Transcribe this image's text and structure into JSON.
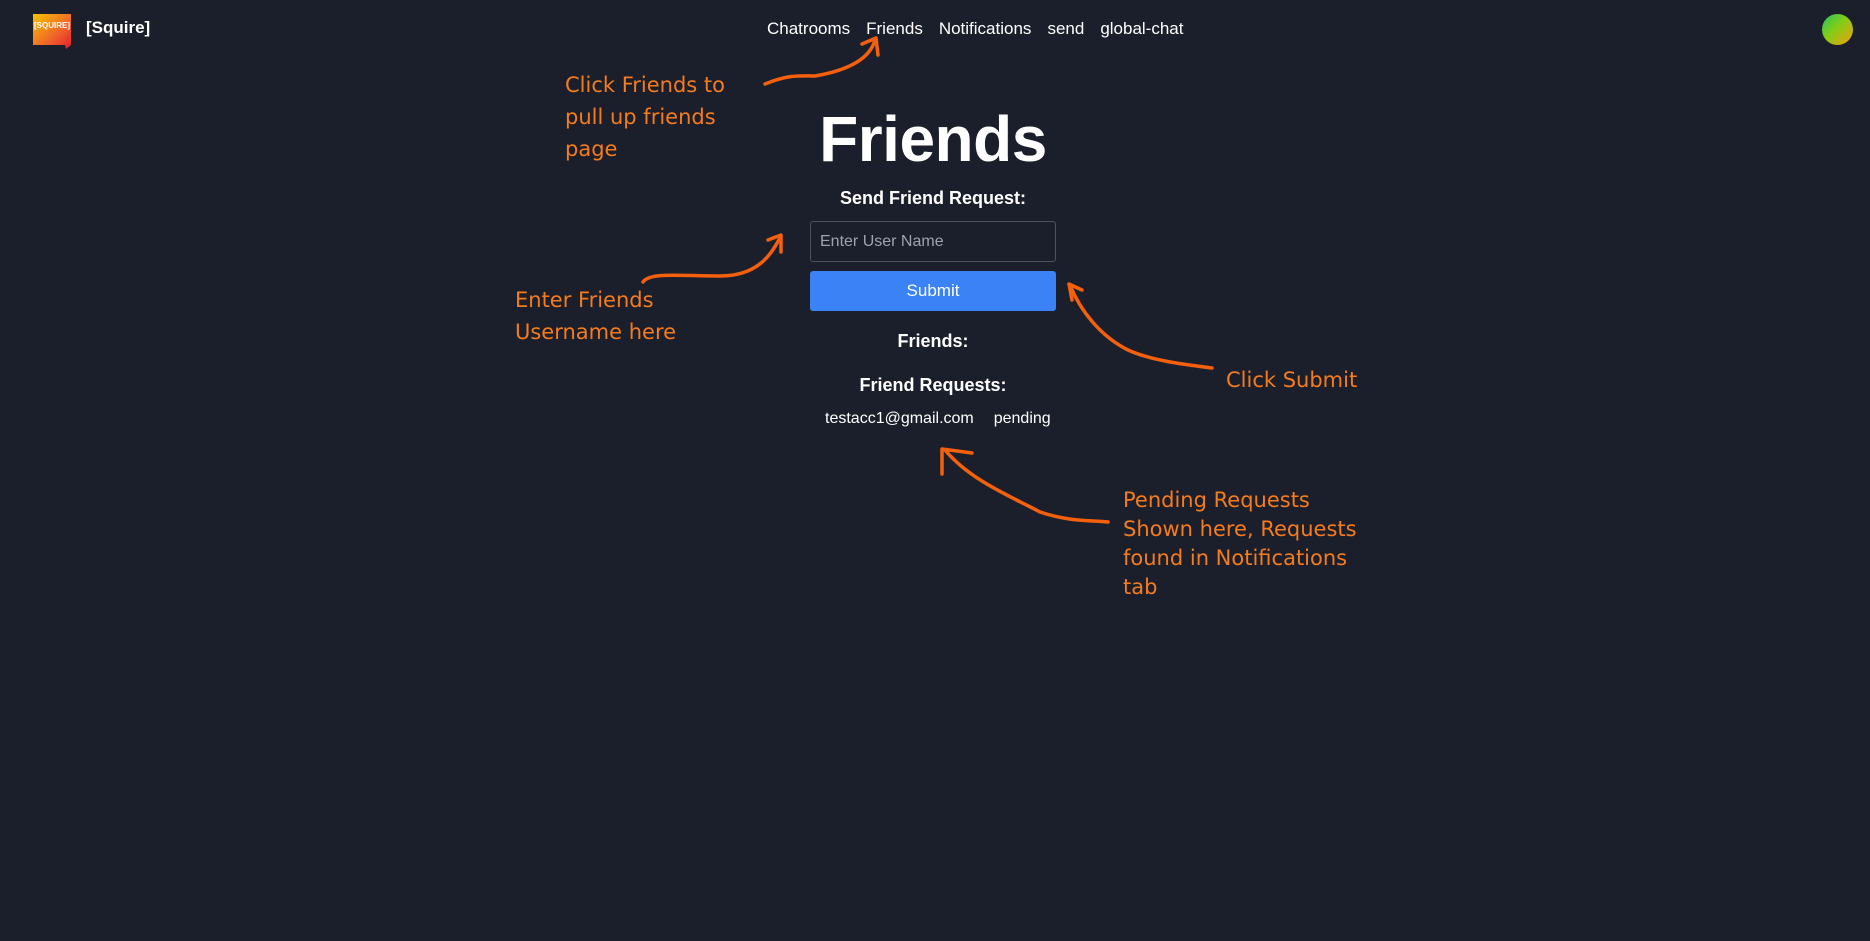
{
  "header": {
    "logo_text": "[SQUIRE]",
    "brand": "[Squire]",
    "nav": [
      {
        "label": "Chatrooms"
      },
      {
        "label": "Friends"
      },
      {
        "label": "Notifications"
      },
      {
        "label": "send"
      },
      {
        "label": "global-chat"
      }
    ]
  },
  "main": {
    "title": "Friends",
    "send_request_label": "Send Friend Request:",
    "username_placeholder": "Enter User Name",
    "submit_label": "Submit",
    "friends_label": "Friends:",
    "friend_requests_label": "Friend Requests:",
    "requests": [
      {
        "email": "testacc1@gmail.com",
        "status": "pending"
      }
    ]
  },
  "annotations": {
    "friends_nav_note": [
      "Click Friends to",
      "pull up friends",
      "page"
    ],
    "username_note": [
      "Enter Friends",
      "Username here"
    ],
    "submit_note": "Click Submit",
    "pending_note": [
      "Pending Requests",
      "Shown here, Requests",
      "found in Notifications",
      "tab"
    ],
    "color": "#f57b1f"
  },
  "colors": {
    "background": "#1b1f2b",
    "accent": "#3b82f6"
  }
}
